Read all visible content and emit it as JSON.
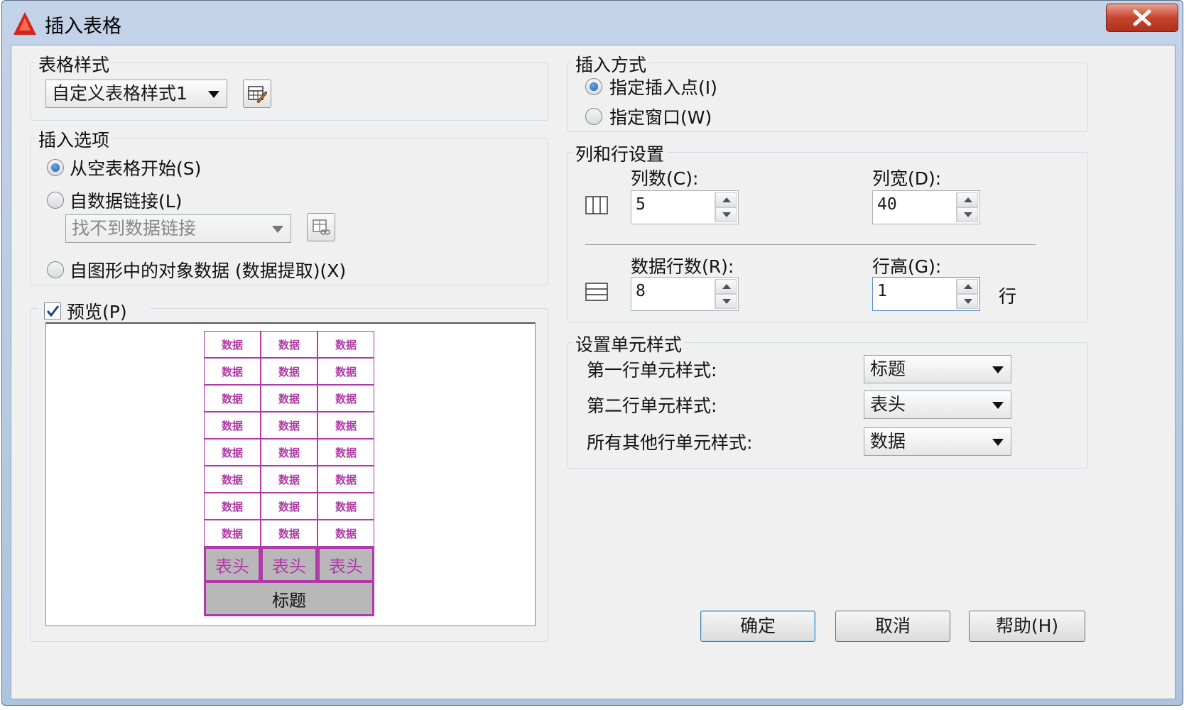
{
  "window": {
    "title": "插入表格"
  },
  "table_style": {
    "group_title": "表格样式",
    "selected": "自定义表格样式1",
    "edit_icon": "table-style-edit-icon"
  },
  "insert_options": {
    "group_title": "插入选项",
    "from_empty": "从空表格开始(S)",
    "from_data_link": "自数据链接(L)",
    "data_link_value": "找不到数据链接",
    "from_object_data": "自图形中的对象数据 (数据提取)(X)",
    "selected": "from_empty"
  },
  "preview": {
    "label": "预览(P)",
    "checked": true,
    "data_cell": "数据",
    "header_cell": "表头",
    "title_cell": "标题",
    "columns": 3,
    "data_rows": 8
  },
  "insert_method": {
    "group_title": "插入方式",
    "point": "指定插入点(I)",
    "window": "指定窗口(W)",
    "selected": "point"
  },
  "col_row": {
    "group_title": "列和行设置",
    "columns_label": "列数(C):",
    "columns_value": "5",
    "col_width_label": "列宽(D):",
    "col_width_value": "40",
    "data_rows_label": "数据行数(R):",
    "data_rows_value": "8",
    "row_height_label": "行高(G):",
    "row_height_value": "1",
    "row_unit": "行"
  },
  "cell_styles": {
    "group_title": "设置单元样式",
    "first_row_label": "第一行单元样式:",
    "first_row_value": "标题",
    "second_row_label": "第二行单元样式:",
    "second_row_value": "表头",
    "other_rows_label": "所有其他行单元样式:",
    "other_rows_value": "数据"
  },
  "buttons": {
    "ok": "确定",
    "cancel": "取消",
    "help": "帮助(H)"
  },
  "colors": {
    "preview_accent": "#b03aa8",
    "close_button": "#c8452f"
  }
}
